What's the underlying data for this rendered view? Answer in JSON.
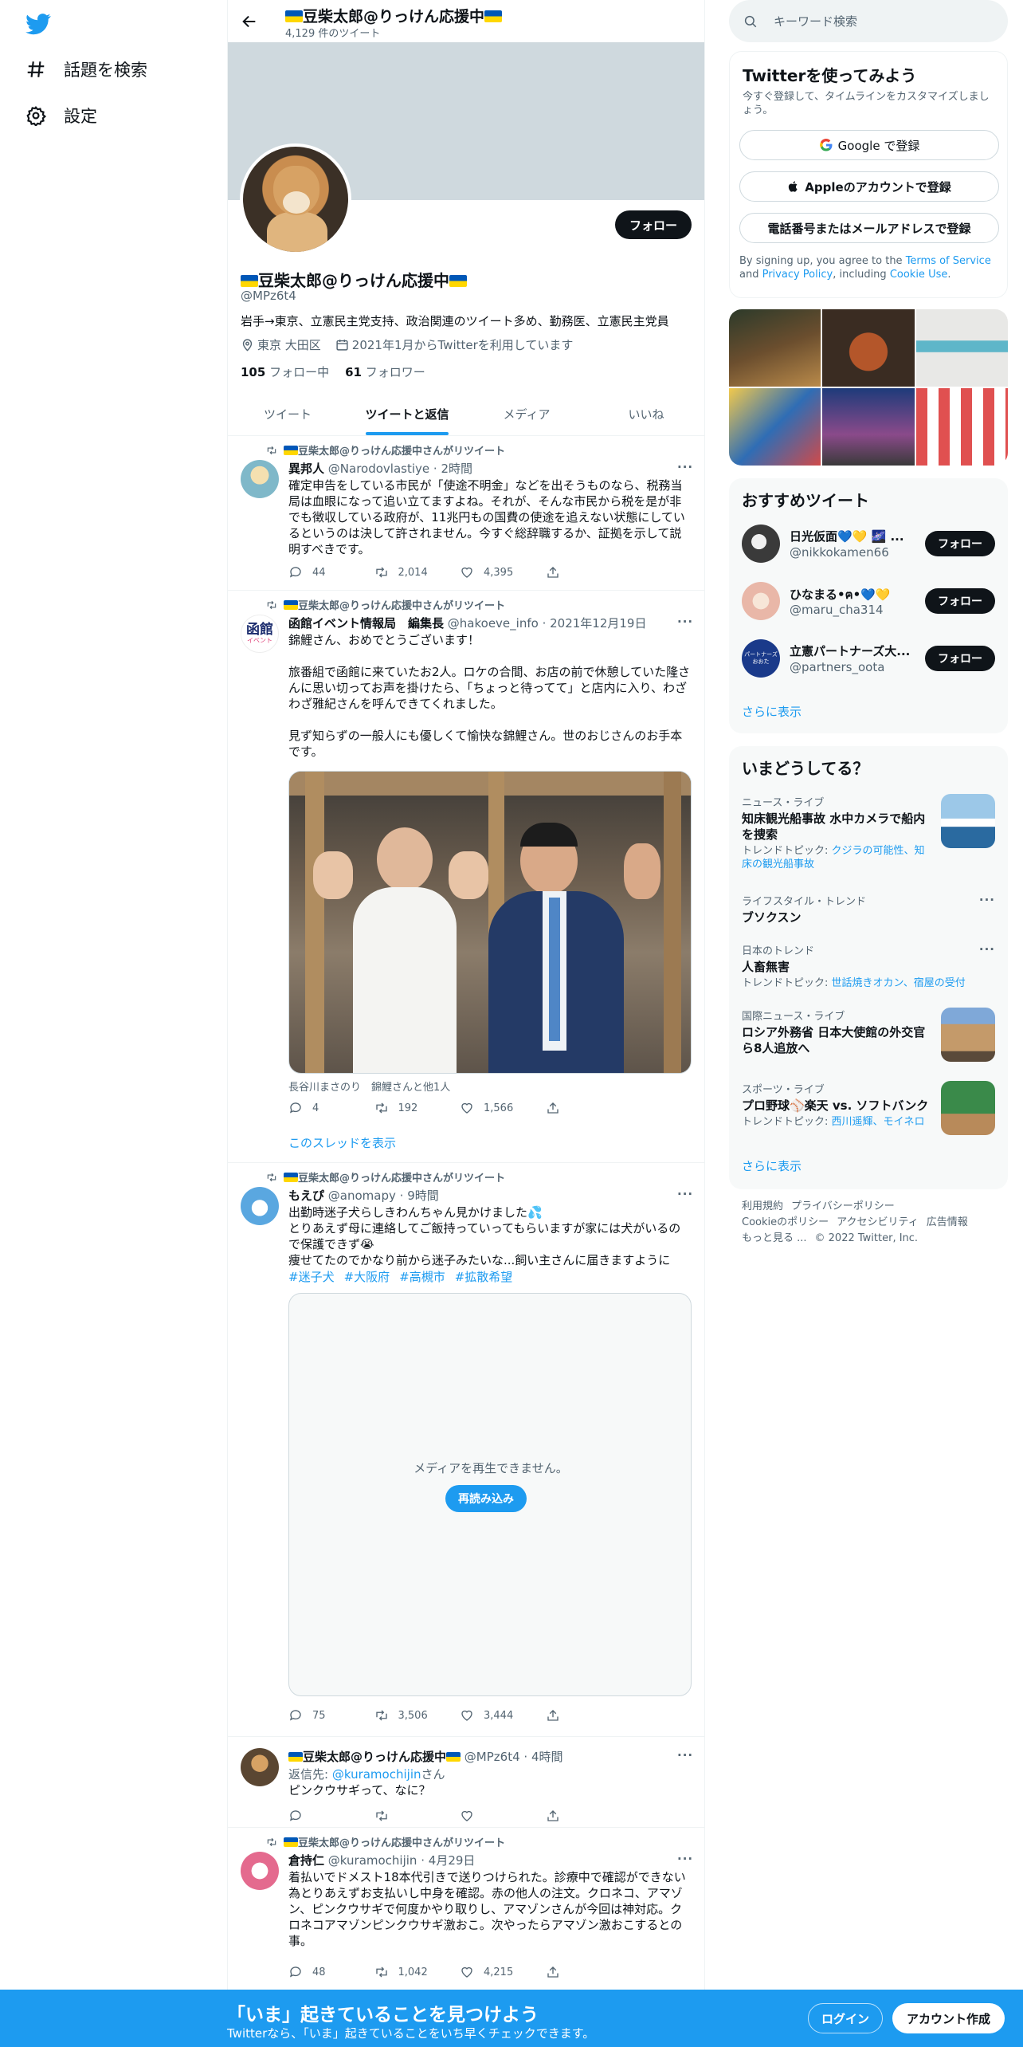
{
  "nav": {
    "explore": "話題を検索",
    "settings": "設定"
  },
  "profile": {
    "title": "豆柴太郎@りっけん応援中",
    "tweet_count": "4,129 件のツイート",
    "name": "豆柴太郎@りっけん応援中",
    "handle": "@MPz6t4",
    "bio": "岩手→東京、立憲民主党支持、政治関連のツイート多め、勤務医、立憲民主党員",
    "location": "東京 大田区",
    "joined": "2021年1月からTwitterを利用しています",
    "following_count": "105",
    "following_label": "フォロー中",
    "followers_count": "61",
    "followers_label": "フォロワー",
    "follow_label": "フォロー"
  },
  "tabs": [
    "ツイート",
    "ツイートと返信",
    "メディア",
    "いいね"
  ],
  "tweets": [
    {
      "retweeted_by": "豆柴太郎@りっけん応援中さんがリツイート",
      "name": "異邦人",
      "handle": "@Narodovlastiye",
      "time": "· 2時間",
      "text": "確定申告をしている市民が「使途不明金」などを出そうものなら、税務当局は血眼になって追い立てますよね。それが、そんな市民から税を是が非でも徴収している政府が、11兆円もの国費の使途を追えない状態にしているというのは決して許されません。今すぐ総辞職するか、証拠を示して説明すべきです。",
      "replies": "44",
      "retweets": "2,014",
      "likes": "4,395"
    },
    {
      "retweeted_by": "豆柴太郎@りっけん応援中さんがリツイート",
      "name": "函館イベント情報局　編集長",
      "handle": "@hakoeve_info",
      "time": "· 2021年12月19日",
      "avatar_text": "函館",
      "avatar_sub": "イベント",
      "text": "錦鯉さん、おめでとうございます！\n\n旅番組で函館に来ていたお2人。ロケの合間、お店の前で休憩していた隆さんに思い切ってお声を掛けたら、「ちょっと待ってて」と店内に入り、わざわざ雅紀さんを呼んできてくれました。\n\n見ず知らずの一般人にも優しくて愉快な錦鯉さん。世のおじさんのお手本です。",
      "caption": "長谷川まさのり　錦鯉さんと他1人",
      "replies": "4",
      "retweets": "192",
      "likes": "1,566",
      "show_thread": "このスレッドを表示"
    },
    {
      "retweeted_by": "豆柴太郎@りっけん応援中さんがリツイート",
      "name": "もえぴ",
      "handle": "@anomapy",
      "time": "· 9時間",
      "text": "出勤時迷子犬らしきわんちゃん見かけました💦\nとりあえず母に連絡してご飯持っていってもらいますが家には犬がいるので保護できず😭\n痩せてたのでかなり前から迷子みたいな...飼い主さんに届きますように",
      "hashtags": [
        "#迷子犬",
        "#大阪府",
        "#高槻市",
        "#拡散希望"
      ],
      "media_error": "メディアを再生できません。",
      "reload": "再読み込み",
      "replies": "75",
      "retweets": "3,506",
      "likes": "3,444"
    },
    {
      "name": "豆柴太郎@りっけん応援中",
      "handle": "@MPz6t4",
      "time": "· 4時間",
      "reply_to_label": "返信先:",
      "reply_to": "@kuramochijin",
      "reply_to_suffix": "さん",
      "text": "ピンクウサギって、なに？"
    },
    {
      "retweeted_by": "豆柴太郎@りっけん応援中さんがリツイート",
      "name": "倉持仁",
      "handle": "@kuramochijin",
      "time": "· 4月29日",
      "text": "着払いでドメスト18本代引きで送りつけられた。診療中で確認ができない為とりあえずお支払いし中身を確認。赤の他人の注文。クロネコ、アマゾン、ピンクウサギで何度かやり取りし、アマゾンさんが今回は神対応。クロネコアマゾンピンクウサギ激おこ。次やったらアマゾン激おこするとの事。",
      "replies": "48",
      "retweets": "1,042",
      "likes": "4,215"
    }
  ],
  "right": {
    "search_placeholder": "キーワード検索",
    "signup": {
      "title": "Twitterを使ってみよう",
      "subtitle": "今すぐ登録して、タイムラインをカスタマイズしましょう。",
      "google": "Google で登録",
      "apple": "Appleのアカウントで登録",
      "phone": "電話番号またはメールアドレスで登録",
      "terms_pre": "By signing up, you agree to the ",
      "terms": "Terms of Service",
      "and": " and ",
      "privacy": "Privacy Policy",
      "including": ", including ",
      "cookie": "Cookie Use",
      "period": "."
    },
    "reco": {
      "title": "おすすめツイート",
      "items": [
        {
          "name": "日光仮面💙💛 🌌 ...",
          "handle": "@nikkokamen66",
          "button": "フォロー"
        },
        {
          "name": "ひなまる•ฅ•💙💛",
          "handle": "@maru_cha314",
          "button": "フォロー"
        },
        {
          "name": "立憲パートナーズ大...",
          "handle": "@partners_oota",
          "button": "フォロー",
          "avatar_text": "パートナーズ おおた"
        }
      ],
      "more": "さらに表示"
    },
    "trends": {
      "title": "いまどうしてる？",
      "items": [
        {
          "cat": "ニュース・ライブ",
          "title": "知床観光船事故 水中カメラで船内を捜索",
          "sub_label": "トレンドトピック: ",
          "sub": "クジラの可能性、知床の観光船事故"
        },
        {
          "cat": "ライフスタイル・トレンド",
          "title": "ブソクスン"
        },
        {
          "cat": "日本のトレンド",
          "title": "人畜無害",
          "sub_label": "トレンドトピック: ",
          "sub": "世話焼きオカン、宿屋の受付"
        },
        {
          "cat": "国際ニュース・ライブ",
          "title": "ロシア外務省 日本大使館の外交官ら8人追放へ"
        },
        {
          "cat": "スポーツ・ライブ",
          "title": "プロ野球⚾楽天 vs. ソフトバンク",
          "sub_label": "トレンドトピック: ",
          "sub": "西川遥輝、モイネロ"
        }
      ],
      "more": "さらに表示"
    },
    "footer": {
      "line1": [
        "利用規約",
        "プライバシーポリシー"
      ],
      "line2": [
        "Cookieのポリシー",
        "アクセシビリティ",
        "広告情報"
      ],
      "line3": [
        "もっと見る ...",
        "© 2022 Twitter, Inc."
      ]
    }
  },
  "bottom": {
    "headline": "「いま」起きていることを見つけよう",
    "sub": "Twitterなら、「いま」起きていることをいち早くチェックできます。",
    "login": "ログイン",
    "signup": "アカウント作成"
  },
  "colors": {
    "accent": "#1d9bf0",
    "text": "#0f1419",
    "muted": "#536471",
    "border": "#eff3f4"
  }
}
